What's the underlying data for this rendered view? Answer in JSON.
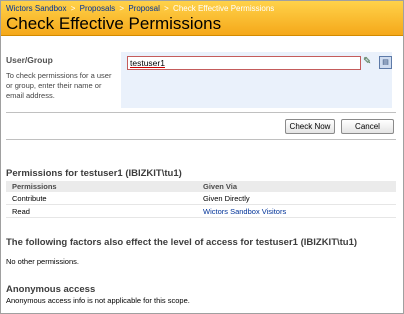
{
  "breadcrumb": {
    "items": [
      "Wictors Sandbox",
      "Proposals",
      "Proposal"
    ],
    "current": "Check Effective Permissions",
    "separator": ">"
  },
  "page_title": "Check Effective Permissions",
  "user_group": {
    "title": "User/Group",
    "description": "To check permissions for a user or group, enter their name or email address.",
    "value": "testuser1"
  },
  "icons": {
    "check_names": "check-names-icon",
    "browse": "address-book-icon"
  },
  "buttons": {
    "check_now": "Check Now",
    "cancel": "Cancel"
  },
  "permissions": {
    "title": "Permissions for testuser1 (IBIZKIT\\tu1)",
    "columns": [
      "Permissions",
      "Given Via"
    ],
    "rows": [
      {
        "permission": "Contribute",
        "via": "Given Directly"
      },
      {
        "permission": "Read",
        "via": "Wictors Sandbox Visitors"
      }
    ]
  },
  "factors": {
    "title": "The following factors also effect the level of access for testuser1 (IBIZKIT\\tu1)",
    "text": "No other permissions."
  },
  "anonymous": {
    "title": "Anonymous access",
    "text": "Anonymous access info is not applicable for this scope."
  }
}
